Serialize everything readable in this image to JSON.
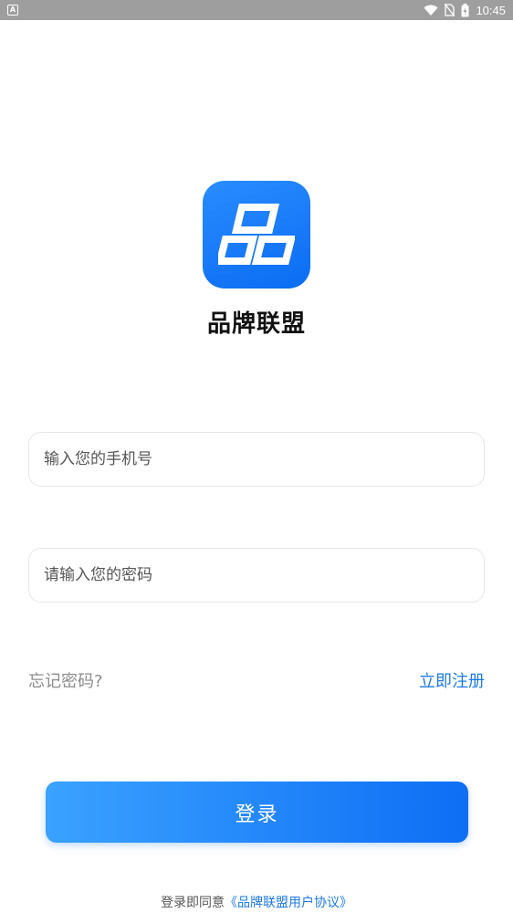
{
  "status_bar": {
    "app_icon_letter": "A",
    "time": "10:45"
  },
  "brand": {
    "app_name": "品牌联盟",
    "logo_color": "#1a7cf5"
  },
  "form": {
    "phone_placeholder": "输入您的手机号",
    "password_placeholder": "请输入您的密码",
    "forgot_label": "忘记密码?",
    "register_label": "立即注册",
    "login_label": "登录"
  },
  "agreement": {
    "prefix": "登录即同意",
    "link_text": "《品牌联盟用户协议》"
  },
  "colors": {
    "accent": "#1e7ae6",
    "button_gradient_start": "#3aa2ff",
    "button_gradient_end": "#0e6ef5"
  }
}
